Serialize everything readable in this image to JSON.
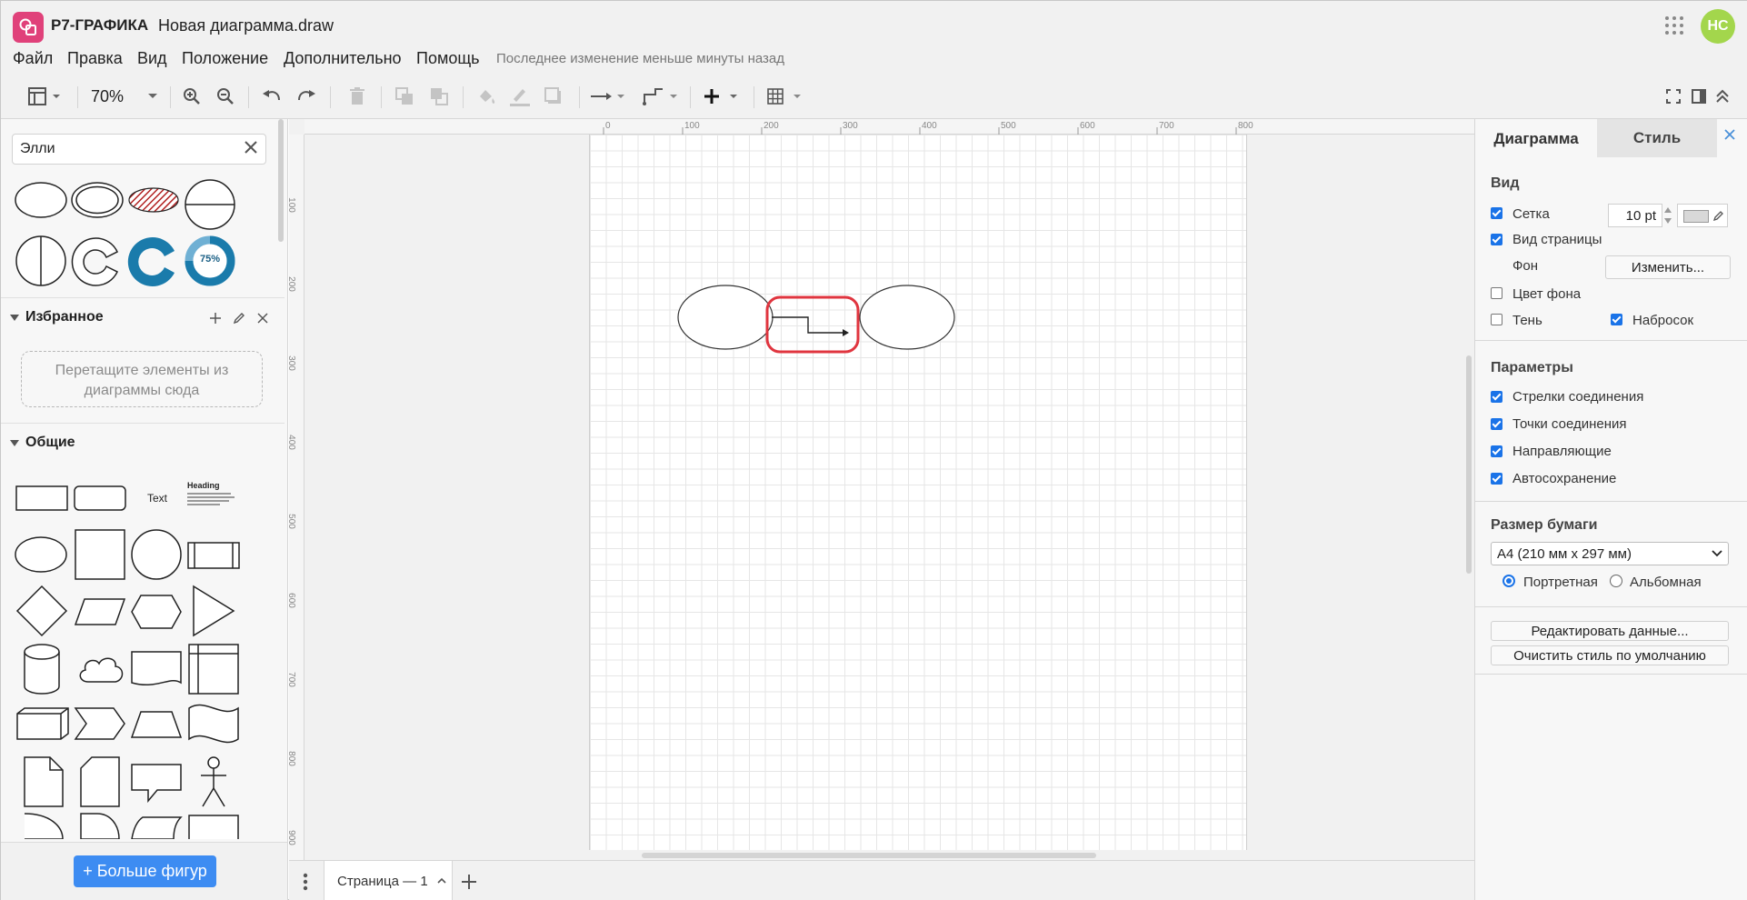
{
  "app": {
    "name": "Р7-ГРАФИКА",
    "document_title": "Новая диаграмма.draw",
    "user_initials": "НС",
    "avatar_color": "#a3d64c",
    "logo_color": "#e0417a"
  },
  "menu": {
    "items": [
      "Файл",
      "Правка",
      "Вид",
      "Положение",
      "Дополнительно",
      "Помощь"
    ],
    "status": "Последнее изменение меньше минуты назад"
  },
  "toolbar": {
    "zoom": "70%",
    "icons": [
      "layout-icon",
      "zoom-in-icon",
      "zoom-out-icon",
      "undo-icon",
      "redo-icon",
      "delete-icon",
      "to-front-icon",
      "to-back-icon",
      "fill-color-icon",
      "line-color-icon",
      "shadow-icon",
      "connection-style-icon",
      "waypoints-icon",
      "insert-icon",
      "table-icon",
      "fullscreen-icon",
      "format-panel-icon",
      "collapse-icon"
    ]
  },
  "left_panel": {
    "search_value": "Элли",
    "favorites": {
      "title": "Избранное",
      "drop_hint": "Перетащите элементы из диаграммы сюда"
    },
    "general": {
      "title": "Общие"
    },
    "shape_labels": {
      "text_shape": "Text",
      "heading_shape": "Heading",
      "donut_percent": "75%"
    },
    "more_shapes_button": "+ Больше фигур"
  },
  "canvas": {
    "ruler_top": [
      "0",
      "100",
      "200",
      "300",
      "400",
      "500",
      "600",
      "700",
      "800"
    ],
    "ruler_left": [
      "100",
      "200",
      "300",
      "400",
      "500",
      "600",
      "700",
      "800",
      "900"
    ]
  },
  "pages": {
    "current": "Страница — 1"
  },
  "right_panel": {
    "tabs": [
      "Диаграмма",
      "Стиль"
    ],
    "view": {
      "title": "Вид",
      "grid_label": "Сетка",
      "grid_checked": true,
      "grid_size": "10 pt",
      "page_view_label": "Вид страницы",
      "page_view_checked": true,
      "background_label": "Фон",
      "background_button": "Изменить...",
      "bg_color_label": "Цвет фона",
      "bg_color_checked": false,
      "shadow_label": "Тень",
      "shadow_checked": false,
      "sketch_label": "Набросок",
      "sketch_checked": true
    },
    "options": {
      "title": "Параметры",
      "items": [
        {
          "label": "Стрелки соединения",
          "checked": true
        },
        {
          "label": "Точки соединения",
          "checked": true
        },
        {
          "label": "Направляющие",
          "checked": true
        },
        {
          "label": "Автосохранение",
          "checked": true
        }
      ]
    },
    "paper": {
      "title": "Размер бумаги",
      "size": "A4 (210 мм x 297 мм)",
      "portrait": "Портретная",
      "landscape": "Альбомная",
      "orientation": "portrait"
    },
    "buttons": {
      "edit_data": "Редактировать данные...",
      "clear_default_style": "Очистить стиль по умолчанию"
    }
  },
  "colors": {
    "accent": "#1a73e8",
    "primary_button": "#3d8cf2",
    "selection_highlight": "#e0353f"
  }
}
